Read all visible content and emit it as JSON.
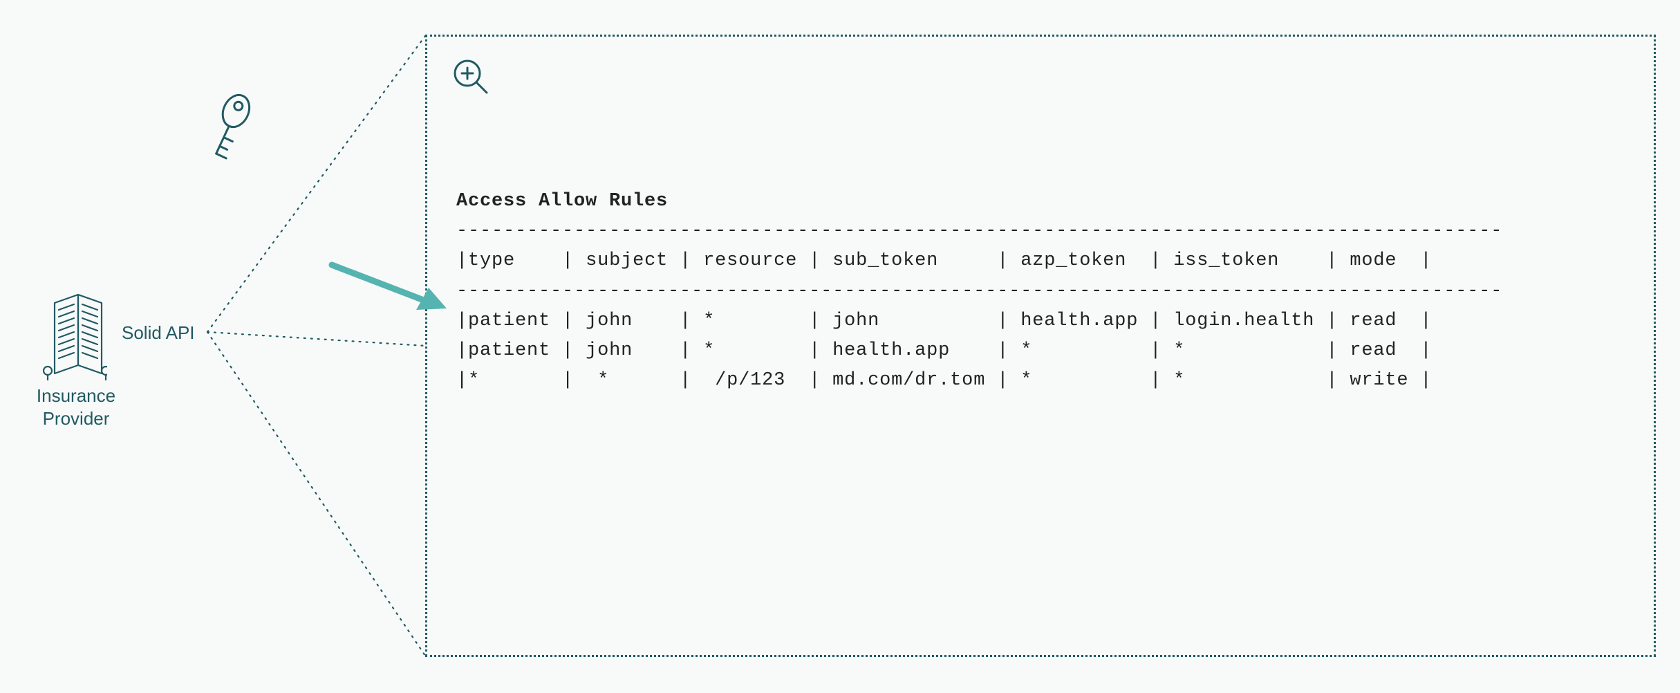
{
  "left": {
    "api_label": "Solid API",
    "provider_line1": "Insurance",
    "provider_line2": "Provider"
  },
  "rules": {
    "title": "Access Allow Rules",
    "columns": [
      "type",
      "subject",
      "resource",
      "sub_token",
      "azp_token",
      "iss_token",
      "mode"
    ],
    "rows": [
      {
        "type": "patient",
        "subject": "john",
        "resource": "*",
        "sub_token": "john",
        "azp_token": "health.app",
        "iss_token": "login.health",
        "mode": "read"
      },
      {
        "type": "patient",
        "subject": "john",
        "resource": "*",
        "sub_token": "health.app",
        "azp_token": "*",
        "iss_token": "*",
        "mode": "read"
      },
      {
        "type": "*",
        "subject": " *",
        "resource": " /p/123",
        "sub_token": "md.com/dr.tom",
        "azp_token": "*",
        "iss_token": "*",
        "mode": "write"
      }
    ]
  },
  "icons": {
    "building": "building-icon",
    "key": "key-icon",
    "zoom": "zoom-icon",
    "arrow": "arrow-icon"
  },
  "colors": {
    "accent": "#215a62",
    "arrow": "#55b4b0",
    "bg": "#f8fafa"
  }
}
